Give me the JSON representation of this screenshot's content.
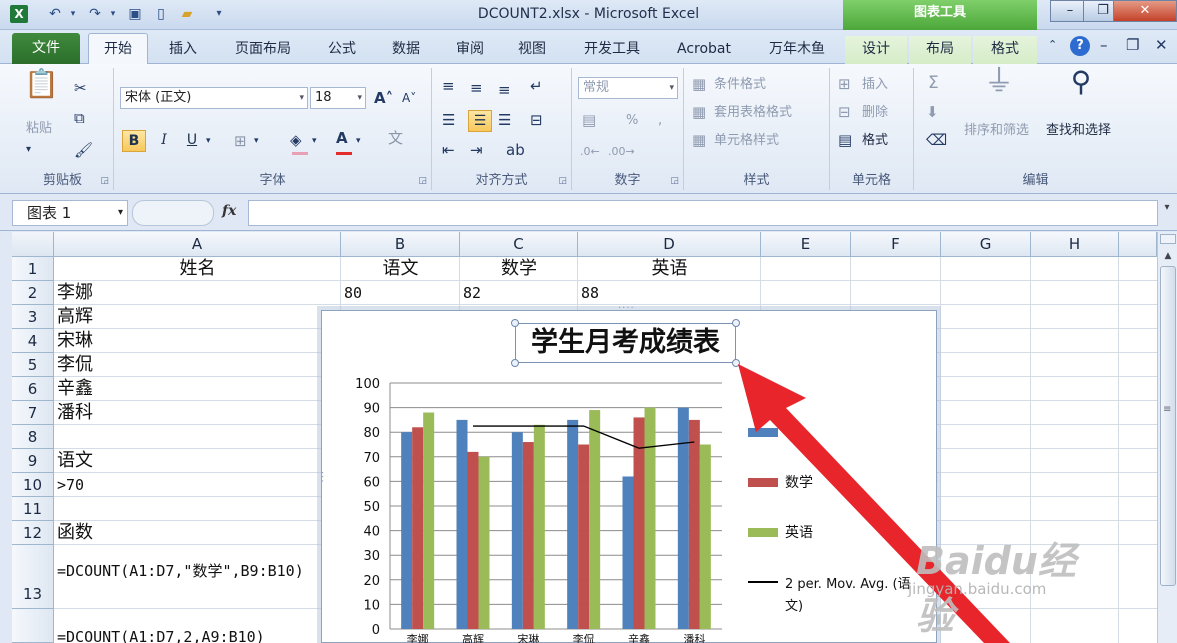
{
  "window": {
    "title": "DCOUNT2.xlsx - Microsoft Excel",
    "context_banner": "图表工具",
    "minimize": "–",
    "restore": "❐",
    "close": "✕"
  },
  "tabs": [
    {
      "label": "文件"
    },
    {
      "label": "开始"
    },
    {
      "label": "插入"
    },
    {
      "label": "页面布局"
    },
    {
      "label": "公式"
    },
    {
      "label": "数据"
    },
    {
      "label": "审阅"
    },
    {
      "label": "视图"
    },
    {
      "label": "开发工具"
    },
    {
      "label": "Acrobat"
    },
    {
      "label": "万年木鱼"
    },
    {
      "label": "设计"
    },
    {
      "label": "布局"
    },
    {
      "label": "格式"
    }
  ],
  "ribbon": {
    "clipboard": {
      "label": "剪贴板",
      "paste": "粘贴"
    },
    "font": {
      "label": "字体",
      "font_name": "宋体 (正文)",
      "font_size": "18",
      "bold": "B",
      "italic": "I",
      "underline": "U"
    },
    "alignment": {
      "label": "对齐方式"
    },
    "number": {
      "label": "数字",
      "format": "常规",
      "percent": "%",
      "comma": ","
    },
    "styles": {
      "label": "样式",
      "conditional": "条件格式",
      "table_format": "套用表格格式",
      "cell_style": "单元格样式"
    },
    "cells": {
      "label": "单元格",
      "insert": "插入",
      "delete": "删除",
      "format": "格式"
    },
    "editing": {
      "label": "编辑",
      "sort_filter": "排序和筛选",
      "find_select": "查找和选择",
      "sum": "Σ"
    }
  },
  "formula_bar": {
    "name_box": "图表 1",
    "fx": "fx",
    "formula": ""
  },
  "grid": {
    "columns": [
      "A",
      "B",
      "C",
      "D",
      "E",
      "F",
      "G",
      "H"
    ],
    "rows": [
      "1",
      "2",
      "3",
      "4",
      "5",
      "6",
      "7",
      "8",
      "9",
      "10",
      "11",
      "12",
      "13"
    ],
    "cells": {
      "A1": "姓名",
      "B1": "语文",
      "C1": "数学",
      "D1": "英语",
      "A2": "李娜",
      "B2": "80",
      "C2": "82",
      "D2": "88",
      "A3": "高辉",
      "A4": "宋琳",
      "A5": "李侃",
      "A6": "辛鑫",
      "A7": "潘科",
      "A9": "语文",
      "A10": ">70",
      "A12": "函数",
      "A13": "=DCOUNT(A1:D7,\"数学\",B9:B10)",
      "A14": "=DCOUNT(A1:D7,2,A9:B10)"
    }
  },
  "chart_data": {
    "type": "bar",
    "title": "学生月考成绩表",
    "ylim": [
      0,
      100
    ],
    "yticks": [
      "0",
      "10",
      "20",
      "30",
      "40",
      "50",
      "60",
      "70",
      "80",
      "90",
      "100"
    ],
    "categories": [
      "李娜",
      "高辉",
      "宋琳",
      "李侃",
      "辛鑫",
      "潘科"
    ],
    "series": [
      {
        "name": "语文",
        "legend_label": "语",
        "color": "#4f81bd",
        "values": [
          80,
          85,
          80,
          85,
          62,
          90
        ]
      },
      {
        "name": "数学",
        "color": "#c0504d",
        "values": [
          82,
          72,
          76,
          75,
          86,
          85
        ]
      },
      {
        "name": "英语",
        "color": "#9bbb59",
        "values": [
          88,
          70,
          83,
          89,
          90,
          75
        ]
      }
    ],
    "trendline": {
      "name": "2 per. Mov. Avg. (语文)",
      "legend_line1": "2 per. Mov. Avg. (语",
      "legend_line2": "文)",
      "color": "#000000",
      "values": [
        null,
        82.5,
        82.5,
        82.5,
        73.5,
        76
      ]
    },
    "grid": true,
    "legend": "right"
  },
  "annotation": {
    "color": "#e8252b"
  },
  "watermark": {
    "brand": "Baidu经验",
    "url": "jingyan.baidu.com"
  }
}
